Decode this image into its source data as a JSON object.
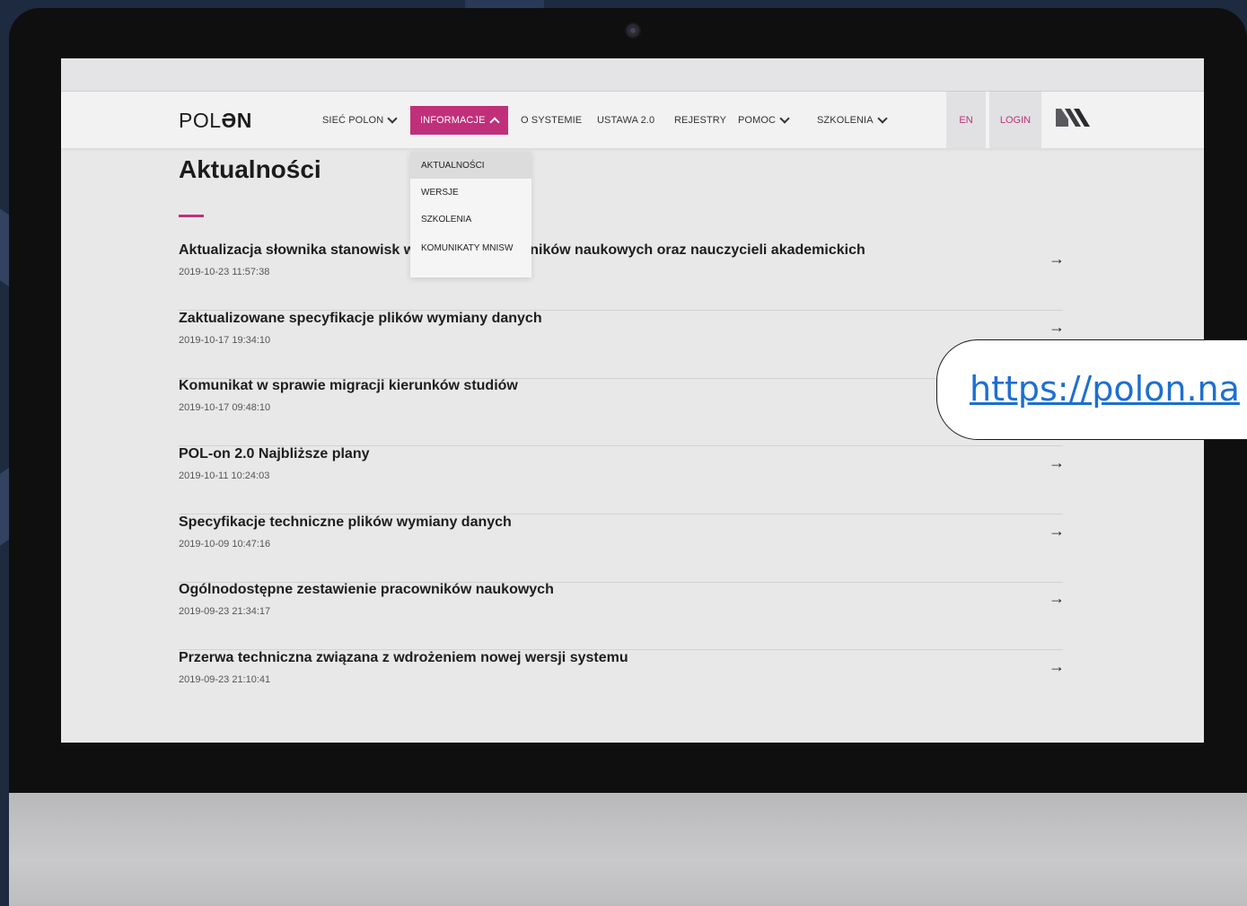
{
  "header": {
    "logo_light": "POL",
    "logo_bold": "ƏN",
    "nav": [
      {
        "label": "SIEĆ POLON",
        "dropdown": true
      },
      {
        "label": "INFORMACJE",
        "dropdown": true,
        "active": true
      },
      {
        "label": "O SYSTEMIE",
        "dropdown": false
      },
      {
        "label": "USTAWA 2.0",
        "dropdown": false
      },
      {
        "label": "REJESTRY",
        "dropdown": false
      },
      {
        "label": "POMOC",
        "dropdown": true
      },
      {
        "label": "SZKOLENIA",
        "dropdown": true
      }
    ],
    "lang": "EN",
    "login": "LOGIN"
  },
  "dropdown": {
    "items": [
      "AKTUALNOŚCI",
      "WERSJE",
      "SZKOLENIA",
      "KOMUNIKATY MNISW"
    ],
    "selected": "AKTUALNOŚCI"
  },
  "main": {
    "title": "Aktualności",
    "news": [
      {
        "headline": "Aktualizacja słownika stanowisk w zakresie pracowników naukowych oraz nauczycieli akademickich",
        "date": "2019-10-23 11:57:38"
      },
      {
        "headline": "Zaktualizowane specyfikacje plików wymiany danych",
        "date": "2019-10-17 19:34:10"
      },
      {
        "headline": "Komunikat w sprawie migracji kierunków studiów",
        "date": "2019-10-17 09:48:10"
      },
      {
        "headline": "POL-on 2.0 Najbliższe plany",
        "date": "2019-10-11 10:24:03"
      },
      {
        "headline": "Specyfikacje techniczne plików wymiany danych",
        "date": "2019-10-09 10:47:16"
      },
      {
        "headline": "Ogólnodostępne zestawienie pracowników naukowych",
        "date": "2019-09-23 21:34:17"
      },
      {
        "headline": "Przerwa techniczna związana z wdrożeniem nowej wersji systemu",
        "date": "2019-09-23 21:10:41"
      }
    ],
    "arrow_glyph": "→"
  },
  "callout": {
    "url_text": "https://polon.na"
  },
  "colors": {
    "accent": "#c0307a",
    "background": "#1d2a40",
    "link": "#1d6fd0"
  }
}
